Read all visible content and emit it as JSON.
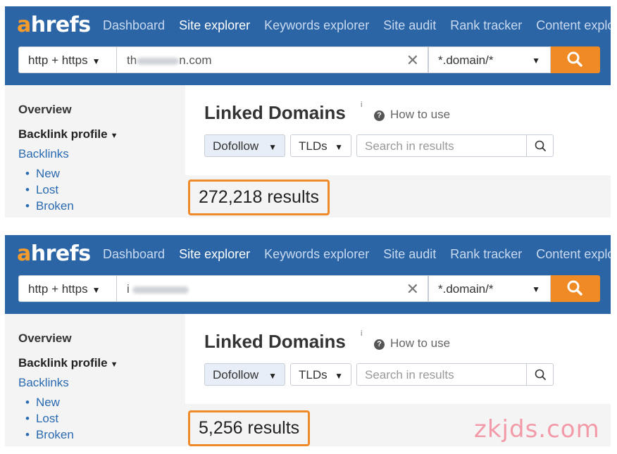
{
  "brand": {
    "logo_a": "a",
    "logo_rest": "hrefs",
    "accent": "#f39c2b",
    "header_bg": "#2b65a6",
    "highlight": "#ef8a28"
  },
  "nav": [
    "Dashboard",
    "Site explorer",
    "Keywords explorer",
    "Site audit",
    "Rank tracker",
    "Content explo"
  ],
  "search": {
    "protocol": "http + https",
    "mode": "*.domain/*",
    "search_icon": "search-icon",
    "clear_icon": "close-icon"
  },
  "sidebar": {
    "overview": "Overview",
    "backlink_profile": "Backlink profile",
    "backlinks": "Backlinks",
    "items": [
      "New",
      "Lost",
      "Broken"
    ]
  },
  "main": {
    "title": "Linked Domains",
    "info": "i",
    "howto": "How to use",
    "dofollow": "Dofollow",
    "tlds": "TLDs",
    "search_placeholder": "Search in results"
  },
  "panels": [
    {
      "url_visible_prefix": "th",
      "url_visible_suffix": "n.com",
      "results": "272,218 results"
    },
    {
      "url_visible_prefix": "i",
      "url_visible_suffix": "",
      "results": "5,256 results"
    }
  ],
  "watermark": "zkjds.com"
}
